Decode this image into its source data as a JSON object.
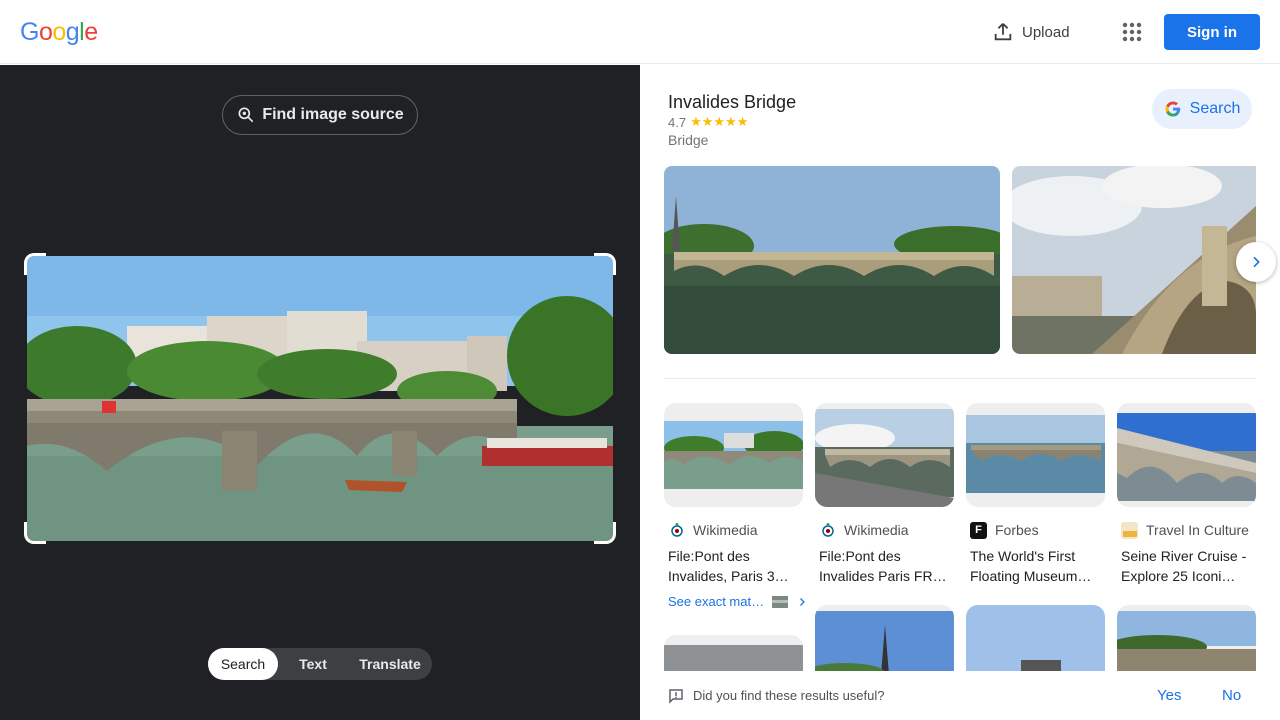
{
  "header": {
    "logo_letters": [
      "G",
      "o",
      "o",
      "g",
      "l",
      "e"
    ],
    "upload_label": "Upload",
    "signin_label": "Sign in",
    "apps_icon": "apps-grid-icon"
  },
  "left_panel": {
    "find_source_label": "Find image source",
    "modes": [
      {
        "label": "Search",
        "active": true
      },
      {
        "label": "Text",
        "active": false
      },
      {
        "label": "Translate",
        "active": false
      }
    ]
  },
  "knowledge_panel": {
    "title": "Invalides Bridge",
    "rating": "4.7",
    "stars": "★★★★★",
    "type": "Bridge",
    "search_label": "Search"
  },
  "results": [
    {
      "source": "Wikimedia",
      "title": "File:Pont des Invalides, Paris 3…",
      "favicon": "wikimedia-icon"
    },
    {
      "source": "Wikimedia",
      "title": "File:Pont des Invalides Paris FR…",
      "favicon": "wikimedia-icon"
    },
    {
      "source": "Forbes",
      "title": "The World's First Floating Museum…",
      "favicon": "forbes-icon",
      "favicon_letter": "F"
    },
    {
      "source": "Travel In Culture",
      "title": "Seine River Cruise - Explore 25 Iconi…",
      "favicon": "travel-in-culture-icon"
    }
  ],
  "exact_matches_label": "See exact mat…",
  "feedback": {
    "question": "Did you find these results useful?",
    "yes_label": "Yes",
    "no_label": "No"
  },
  "colors": {
    "brand_blue": "#1a73e8",
    "dark_panel": "#202124",
    "star_yellow": "#fbbc04"
  }
}
